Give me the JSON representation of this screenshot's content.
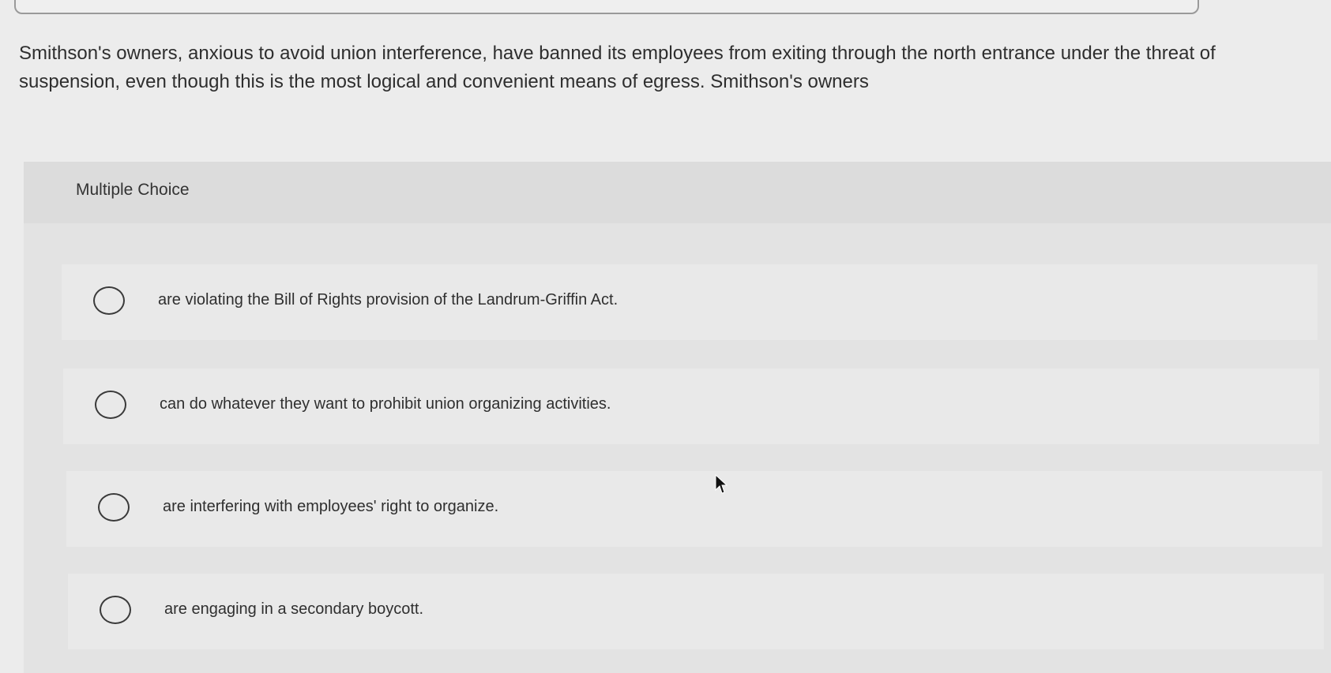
{
  "question": {
    "text": "Smithson's owners, anxious to avoid union interference, have banned its employees from exiting through the north entrance under the threat of suspension, even though this is the most logical and convenient means of egress. Smithson's owners"
  },
  "multiple_choice": {
    "title": "Multiple Choice",
    "options": [
      {
        "label": "are violating the Bill of Rights provision of the Landrum-Griffin Act."
      },
      {
        "label": "can do whatever they want to prohibit union organizing activities."
      },
      {
        "label": "are interfering with employees' right to organize."
      },
      {
        "label": "are engaging in a secondary boycott."
      }
    ]
  },
  "icons": {
    "radio": "radio-circle-icon",
    "cursor": "mouse-pointer-icon"
  }
}
